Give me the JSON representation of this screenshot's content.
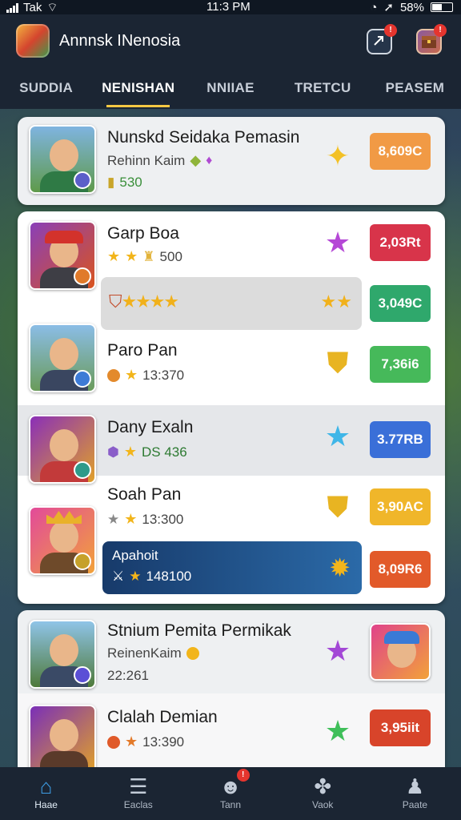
{
  "status": {
    "carrier": "Tak",
    "time": "11:3 PM",
    "battery": "58%"
  },
  "header": {
    "title": "Annnsk INenosia"
  },
  "tabs": [
    {
      "label": "SUDDIA",
      "active": false
    },
    {
      "label": "NENISHAN",
      "active": true
    },
    {
      "label": "NNIIAE",
      "active": false
    },
    {
      "label": "TRETCU",
      "active": false
    },
    {
      "label": "PEASEM",
      "active": false
    }
  ],
  "featured": {
    "name": "Nunskd Seidaka Pemasin",
    "subtitle": "Rehinn Kaim",
    "amount": "530",
    "price": "8,609C"
  },
  "list1": [
    {
      "name": "Garp Boa",
      "meta": "500",
      "price": "2,03Rt"
    },
    {
      "highlight": true,
      "price": "3,049C"
    },
    {
      "name": "Paro Pan",
      "meta": "13:370",
      "price": "7,36i6"
    },
    {
      "name": "Dany Exaln",
      "meta": "DS 436",
      "price": "3.77RB"
    },
    {
      "name": "Soah Pan",
      "meta": "13:300",
      "price": "3,90AC"
    },
    {
      "banner": true,
      "title": "Apahoit",
      "meta": "148100",
      "price": "8,09R6"
    }
  ],
  "list2": [
    {
      "name": "Stnium Pemita Permikak",
      "subtitle": "ReinenKaim",
      "meta": "22:261"
    },
    {
      "name": "Clalah Demian",
      "meta": "13:390",
      "price": "3,95iit"
    }
  ],
  "bottom_nav": [
    {
      "label": "Haae",
      "active": true
    },
    {
      "label": "Eaclas",
      "active": false
    },
    {
      "label": "Tann",
      "active": false,
      "badge": "!"
    },
    {
      "label": "Vaok",
      "active": false
    },
    {
      "label": "Paate",
      "active": false
    }
  ]
}
